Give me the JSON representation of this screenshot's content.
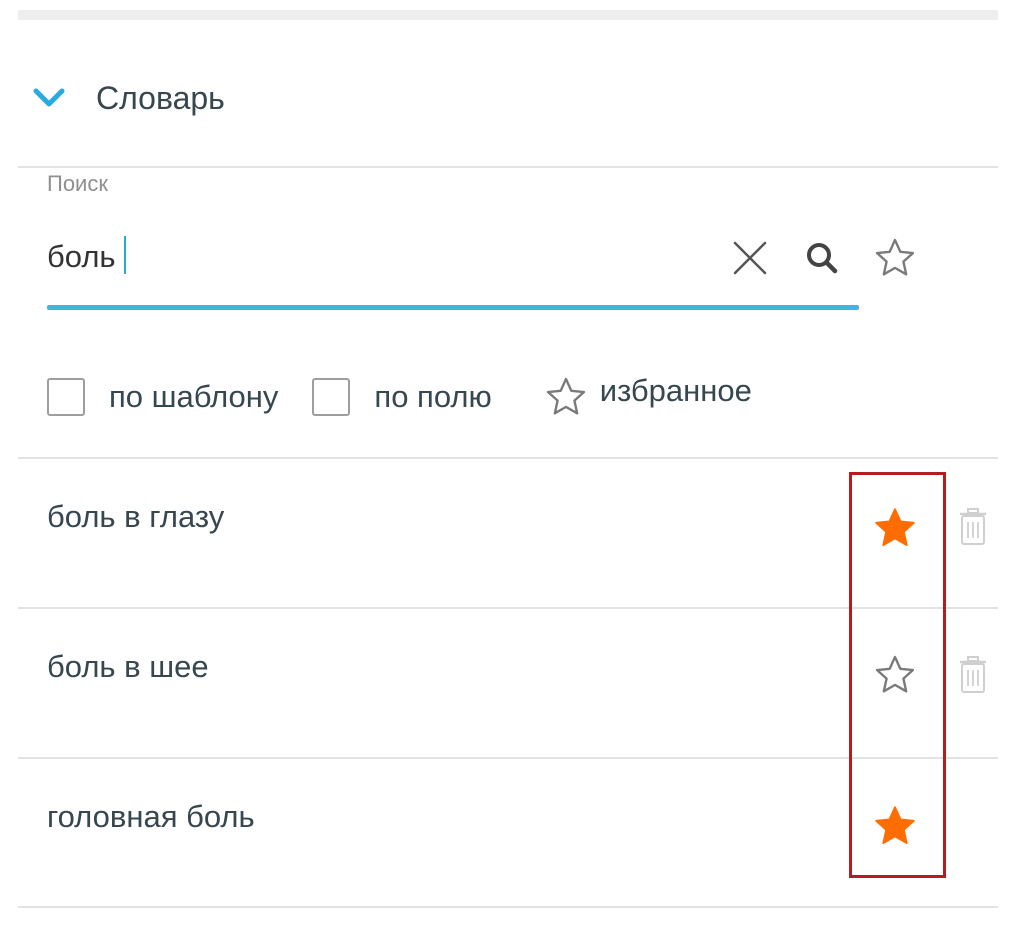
{
  "section": {
    "title": "Словарь",
    "icon": "chevron-down-icon",
    "accent_color": "#29ABE2"
  },
  "search": {
    "label": "Поиск",
    "value": "боль",
    "underline_color": "#3EB6DE"
  },
  "filters": {
    "by_template": "по шаблону",
    "by_field": "по полю",
    "favorites": "избранное"
  },
  "results": [
    {
      "label": "боль в глазу",
      "favorite": true,
      "deletable": true
    },
    {
      "label": "боль в шее",
      "favorite": false,
      "deletable": true
    },
    {
      "label": "головная боль",
      "favorite": true,
      "deletable": false
    }
  ],
  "colors": {
    "favorite_star": "#FF6D00",
    "highlight_frame": "#B71C1C",
    "text": "#37474F"
  }
}
